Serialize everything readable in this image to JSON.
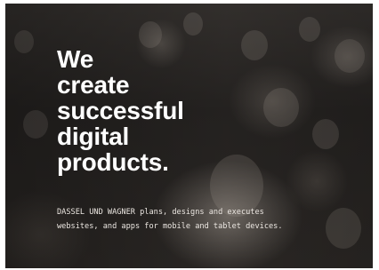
{
  "hero": {
    "headline_lines": [
      "We",
      "create",
      "successful",
      "digital",
      "products."
    ],
    "description": "DASSEL UND WAGNER plans, designs and executes websites, and apps for mobile and tablet devices."
  },
  "colors": {
    "text": "#ffffff",
    "background": "#2e2a27"
  }
}
